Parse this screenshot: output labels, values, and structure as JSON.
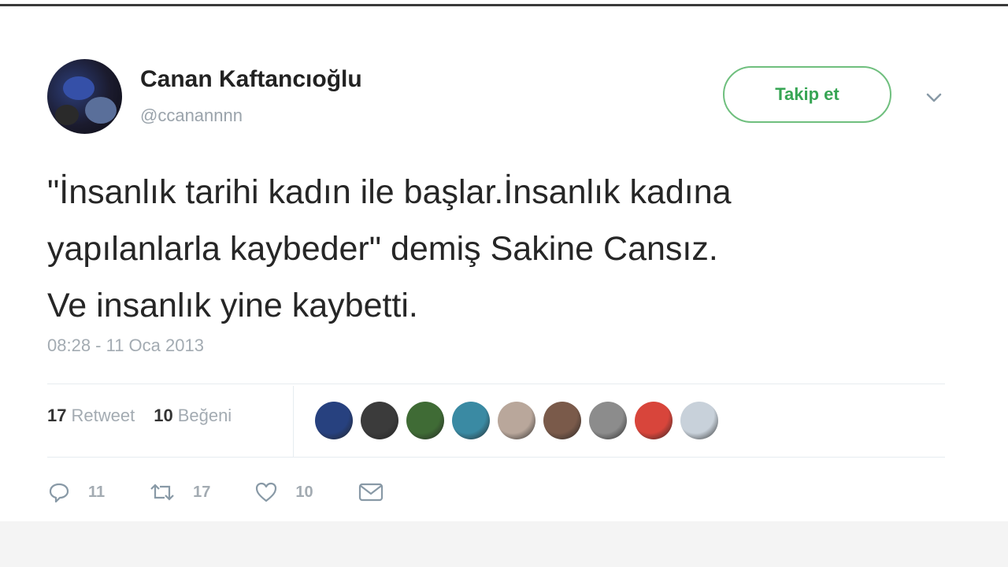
{
  "tweet": {
    "author_name": "Canan Kaftancıoğlu",
    "author_handle": "@ccanannnn",
    "follow_label": "Takip et",
    "text_lines": [
      "\"İnsanlık tarihi kadın ile başlar.İnsanlık kadına",
      "yapılanlarla kaybeder\" demiş Sakine Cansız.",
      "Ve insanlık yine kaybetti."
    ],
    "timestamp": "08:28 - 11 Oca 2013"
  },
  "stats": {
    "retweet_count": "17",
    "retweet_label": "Retweet",
    "like_count": "10",
    "like_label": "Beğeni"
  },
  "likers": [
    {
      "icon": "avatar",
      "color": "#27417f"
    },
    {
      "icon": "avatar",
      "color": "#3b3b3b"
    },
    {
      "icon": "avatar",
      "color": "#3f6b35"
    },
    {
      "icon": "avatar",
      "color": "#3a8aa3"
    },
    {
      "icon": "avatar",
      "color": "#b9a79b"
    },
    {
      "icon": "avatar",
      "color": "#7a5a4a"
    },
    {
      "icon": "avatar",
      "color": "#8c8c8c"
    },
    {
      "icon": "avatar",
      "color": "#d8453b"
    },
    {
      "icon": "avatar",
      "color": "#c8d1da"
    }
  ],
  "actions": {
    "reply_count": "11",
    "retweet_count": "17",
    "like_count": "10"
  },
  "colors": {
    "accent_green": "#37a554",
    "muted_text": "#a3abb2"
  }
}
